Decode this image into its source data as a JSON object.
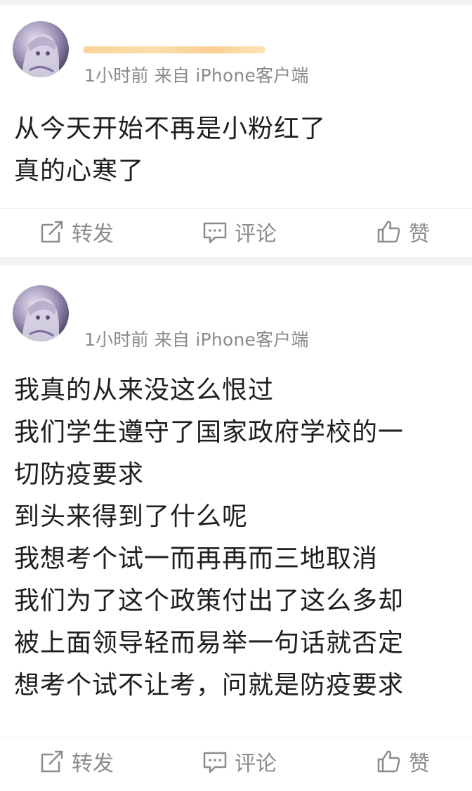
{
  "posts": [
    {
      "meta": "1小时前 来自 iPhone客户端",
      "lines": [
        "从今天开始不再是小粉红了",
        "真的心寒了"
      ],
      "actions": {
        "repost": "转发",
        "comment": "评论",
        "like": "赞"
      }
    },
    {
      "meta": "1小时前 来自 iPhone客户端",
      "lines": [
        "我真的从来没这么恨过",
        "我们学生遵守了国家政府学校的一",
        "切防疫要求",
        "到头来得到了什么呢",
        "我想考个试一而再再而三地取消",
        "我们为了这个政策付出了这么多却",
        "被上面领导轻而易举一句话就否定",
        "想考个试不让考，问就是防疫要求"
      ],
      "actions": {
        "repost": "转发",
        "comment": "评论",
        "like": "赞"
      }
    }
  ],
  "icons": {
    "repost": "repost-icon",
    "comment": "comment-icon",
    "like": "thumbs-up-icon"
  },
  "colors": {
    "background": "#f2f2f2",
    "card": "#ffffff",
    "meta_text": "#8a8a8a",
    "action_text": "#8c8c8c",
    "content_text": "#1e1e1e",
    "username_redacted": "#f6b04a"
  }
}
